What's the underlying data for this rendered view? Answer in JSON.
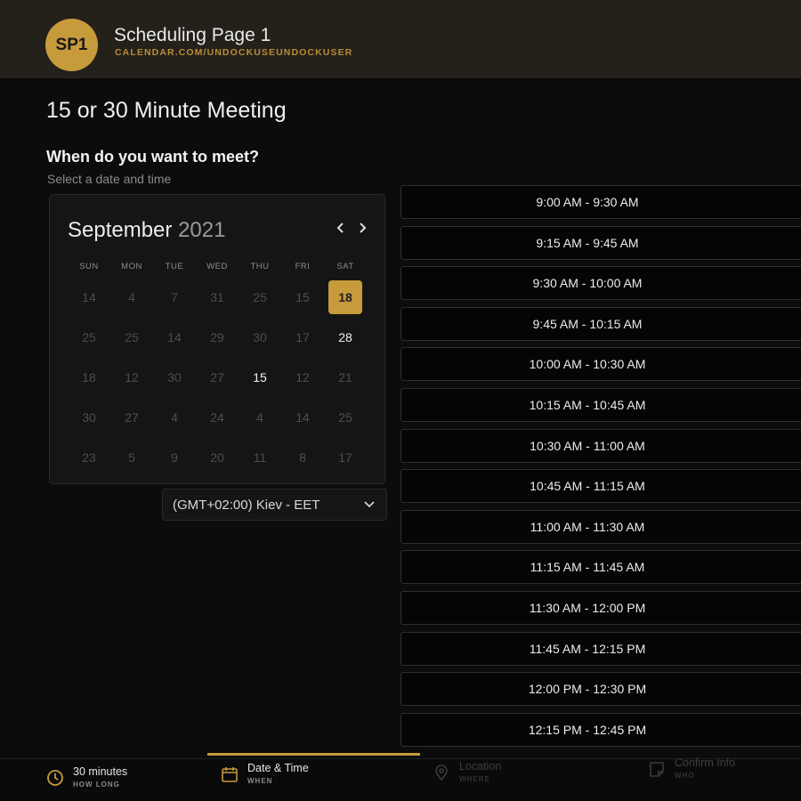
{
  "header": {
    "avatar_initials": "SP1",
    "title": "Scheduling Page 1",
    "url": "CALENDAR.COM/UNDOCKUSEUNDOCKUSER"
  },
  "meeting": {
    "title": "15 or 30 Minute Meeting",
    "heading": "When do you want to meet?",
    "subheading": "Select a date and time"
  },
  "calendar": {
    "month": "September",
    "year": "2021",
    "weekdays": [
      "SUN",
      "MON",
      "TUE",
      "WED",
      "THU",
      "FRI",
      "SAT"
    ],
    "weeks": [
      [
        "14",
        "4",
        "7",
        "31",
        "25",
        "15",
        "18"
      ],
      [
        "25",
        "25",
        "14",
        "29",
        "30",
        "17",
        "28"
      ],
      [
        "18",
        "12",
        "30",
        "27",
        "15",
        "12",
        "21"
      ],
      [
        "30",
        "27",
        "4",
        "24",
        "4",
        "14",
        "25"
      ],
      [
        "23",
        "5",
        "9",
        "20",
        "11",
        "8",
        "17"
      ]
    ],
    "selected_date": "18",
    "available_dates": [
      "28",
      "15"
    ]
  },
  "timezone": {
    "selected": "(GMT+02:00) Kiev - EET"
  },
  "time_slots": [
    "9:00 AM - 9:30 AM",
    "9:15 AM - 9:45 AM",
    "9:30 AM - 10:00 AM",
    "9:45 AM - 10:15 AM",
    "10:00 AM - 10:30 AM",
    "10:15 AM - 10:45 AM",
    "10:30 AM - 11:00 AM",
    "10:45 AM - 11:15 AM",
    "11:00 AM - 11:30 AM",
    "11:15 AM - 11:45 AM",
    "11:30 AM - 12:00 PM",
    "11:45 AM - 12:15 PM",
    "12:00 PM - 12:30 PM",
    "12:15 PM - 12:45 PM"
  ],
  "steps": [
    {
      "label": "30 minutes",
      "sub": "HOW LONG",
      "icon": "clock-icon"
    },
    {
      "label": "Date & Time",
      "sub": "WHEN",
      "icon": "calendar-icon"
    },
    {
      "label": "Location",
      "sub": "WHERE",
      "icon": "map-pin-icon"
    },
    {
      "label": "Confirm Info",
      "sub": "WHO",
      "icon": "document-icon"
    }
  ],
  "colors": {
    "accent": "#c79a3c",
    "background": "#0c0c0c",
    "header_bg": "#24211b"
  }
}
